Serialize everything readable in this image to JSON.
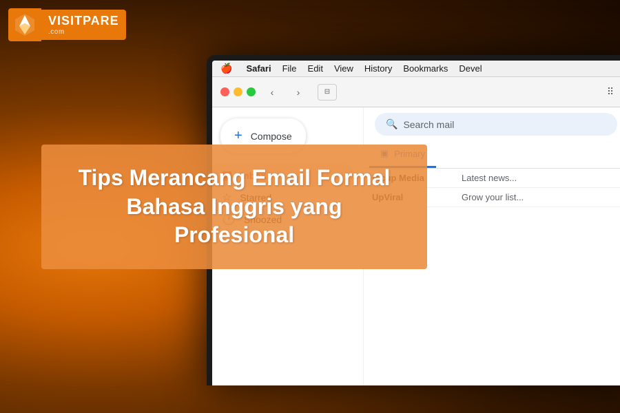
{
  "brand": {
    "name": "VISITPARE",
    "domain": ".com",
    "logo_alt": "VisitPare Logo"
  },
  "macos_menubar": {
    "items": [
      "Safari",
      "File",
      "Edit",
      "View",
      "History",
      "Bookmarks",
      "Devel"
    ]
  },
  "safari": {
    "back_label": "‹",
    "forward_label": "›",
    "tab_icon": "⊟",
    "grid_icon": "⠿"
  },
  "gmail": {
    "search_placeholder": "Search mail",
    "compose_label": "Compose",
    "sidebar_items": [
      {
        "id": "inbox",
        "icon": "📥",
        "label": "Inbox",
        "active": true
      },
      {
        "id": "starred",
        "icon": "☆",
        "label": "Starred",
        "active": false
      },
      {
        "id": "snoozed",
        "icon": "🕐",
        "label": "Snoozed",
        "active": false
      }
    ],
    "tabs": [
      {
        "id": "primary",
        "label": "Primary",
        "icon": "▣",
        "active": true
      }
    ],
    "email_rows": [
      {
        "sender": "Picup Media",
        "subject": "Latest news..."
      },
      {
        "sender": "UpViral",
        "subject": "Grow your list..."
      }
    ]
  },
  "overlay": {
    "title_line1": "Tips Merancang Email Formal",
    "title_line2": "Bahasa Inggris yang Profesional"
  }
}
